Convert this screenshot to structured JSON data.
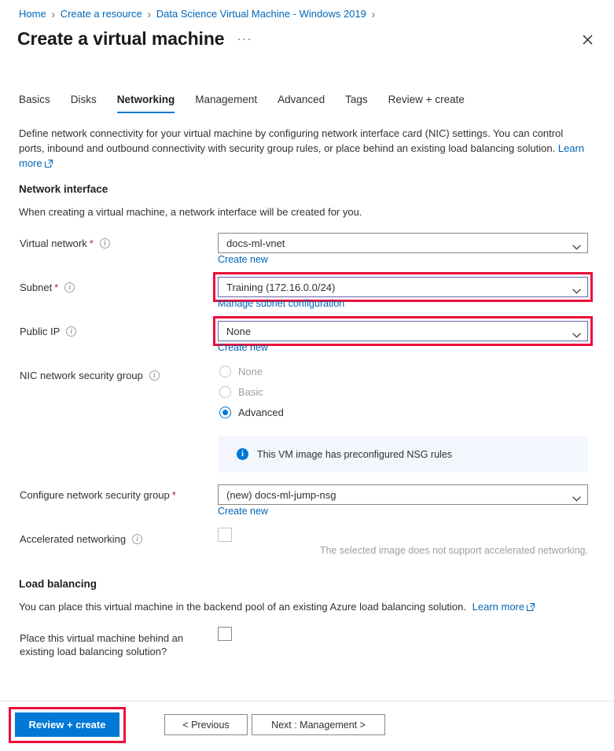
{
  "breadcrumb": {
    "items": [
      {
        "label": "Home"
      },
      {
        "label": "Create a resource"
      },
      {
        "label": "Data Science Virtual Machine - Windows 2019"
      }
    ],
    "separator": "›"
  },
  "header": {
    "title": "Create a virtual machine",
    "more_label": "···",
    "close_label": "✕"
  },
  "tabs": [
    {
      "label": "Basics",
      "active": false
    },
    {
      "label": "Disks",
      "active": false
    },
    {
      "label": "Networking",
      "active": true
    },
    {
      "label": "Management",
      "active": false
    },
    {
      "label": "Advanced",
      "active": false
    },
    {
      "label": "Tags",
      "active": false
    },
    {
      "label": "Review + create",
      "active": false
    }
  ],
  "intro": {
    "text": "Define network connectivity for your virtual machine by configuring network interface card (NIC) settings. You can control ports, inbound and outbound connectivity with security group rules, or place behind an existing load balancing solution.",
    "learn_more": "Learn more"
  },
  "network_interface": {
    "heading": "Network interface",
    "subtext": "When creating a virtual machine, a network interface will be created for you.",
    "virtual_network": {
      "label": "Virtual network",
      "required": "*",
      "value": "docs-ml-vnet",
      "sub_link": "Create new"
    },
    "subnet": {
      "label": "Subnet",
      "required": "*",
      "value": "Training (172.16.0.0/24)",
      "sub_link": "Manage subnet configuration"
    },
    "public_ip": {
      "label": "Public IP",
      "required": "",
      "value": "None",
      "sub_link": "Create new"
    },
    "nic_nsg": {
      "label": "NIC network security group",
      "options": [
        {
          "label": "None",
          "checked": false,
          "disabled": true
        },
        {
          "label": "Basic",
          "checked": false,
          "disabled": true
        },
        {
          "label": "Advanced",
          "checked": true,
          "disabled": false
        }
      ],
      "banner_text": "This VM image has preconfigured NSG rules"
    },
    "configure_nsg": {
      "label": "Configure network security group",
      "required": "*",
      "value": "(new) docs-ml-jump-nsg",
      "sub_link": "Create new"
    },
    "accelerated_networking": {
      "label": "Accelerated networking",
      "checked": false,
      "note": "The selected image does not support accelerated networking."
    }
  },
  "load_balancing": {
    "heading": "Load balancing",
    "subtext": "You can place this virtual machine in the backend pool of an existing Azure load balancing solution.",
    "learn_more": "Learn more",
    "place_behind": {
      "label_line1": "Place this virtual machine behind an",
      "label_line2": "existing load balancing solution?",
      "checked": false
    }
  },
  "footer": {
    "review_create": "Review + create",
    "previous": "< Previous",
    "next": "Next : Management >"
  },
  "colors": {
    "accent": "#0078d4",
    "link": "#0067b8",
    "highlight": "#ec0d3c",
    "required": "#a4262c",
    "banner_bg": "#f3f7fd",
    "disabled_text": "#a19f9d"
  }
}
